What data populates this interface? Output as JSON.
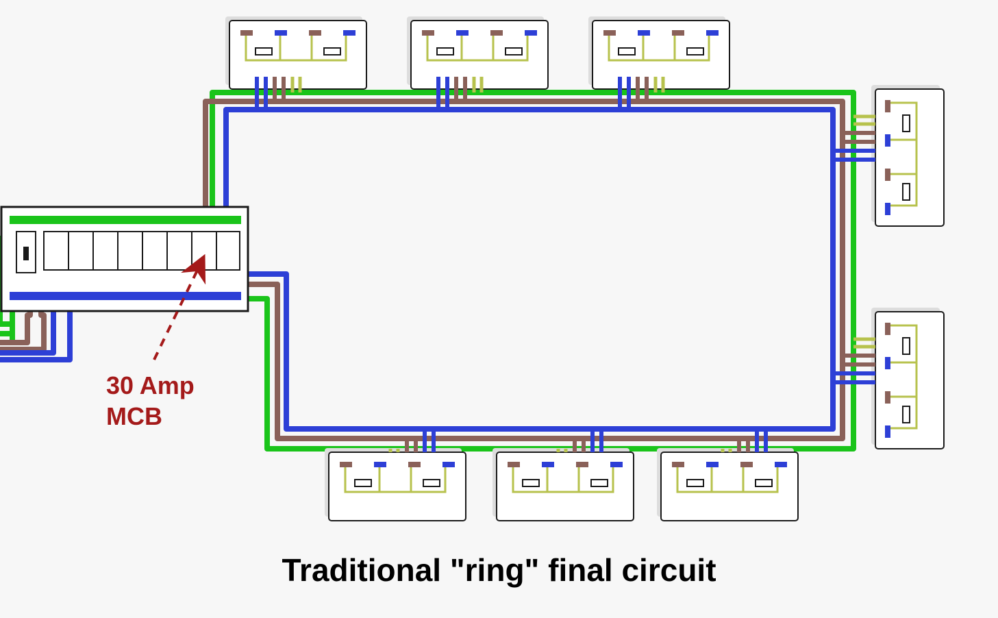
{
  "diagram": {
    "title": "Traditional \"ring\" final circuit",
    "callout": {
      "line1": "30 Amp",
      "line2": "MCB"
    },
    "colors": {
      "live_brown": "#8a6159",
      "neutral_blue": "#2d3fd6",
      "earth_green": "#1ac41a",
      "earth_wire": "#b7c24d",
      "panel": "#ffffff",
      "panel_stroke": "#1a1a1a",
      "callout": "#a41a1a",
      "socket_face": "#ffffff"
    },
    "components": {
      "consumer_unit": {
        "breakers": 8,
        "main_switch": true
      },
      "sockets": [
        {
          "id": "top-1",
          "pos": "top",
          "type": "double"
        },
        {
          "id": "top-2",
          "pos": "top",
          "type": "double"
        },
        {
          "id": "top-3",
          "pos": "top",
          "type": "double"
        },
        {
          "id": "right-1",
          "pos": "right",
          "type": "double"
        },
        {
          "id": "right-2",
          "pos": "right",
          "type": "double"
        },
        {
          "id": "bottom-1",
          "pos": "bottom",
          "type": "double"
        },
        {
          "id": "bottom-2",
          "pos": "bottom",
          "type": "double"
        },
        {
          "id": "bottom-3",
          "pos": "bottom",
          "type": "double"
        }
      ]
    }
  }
}
